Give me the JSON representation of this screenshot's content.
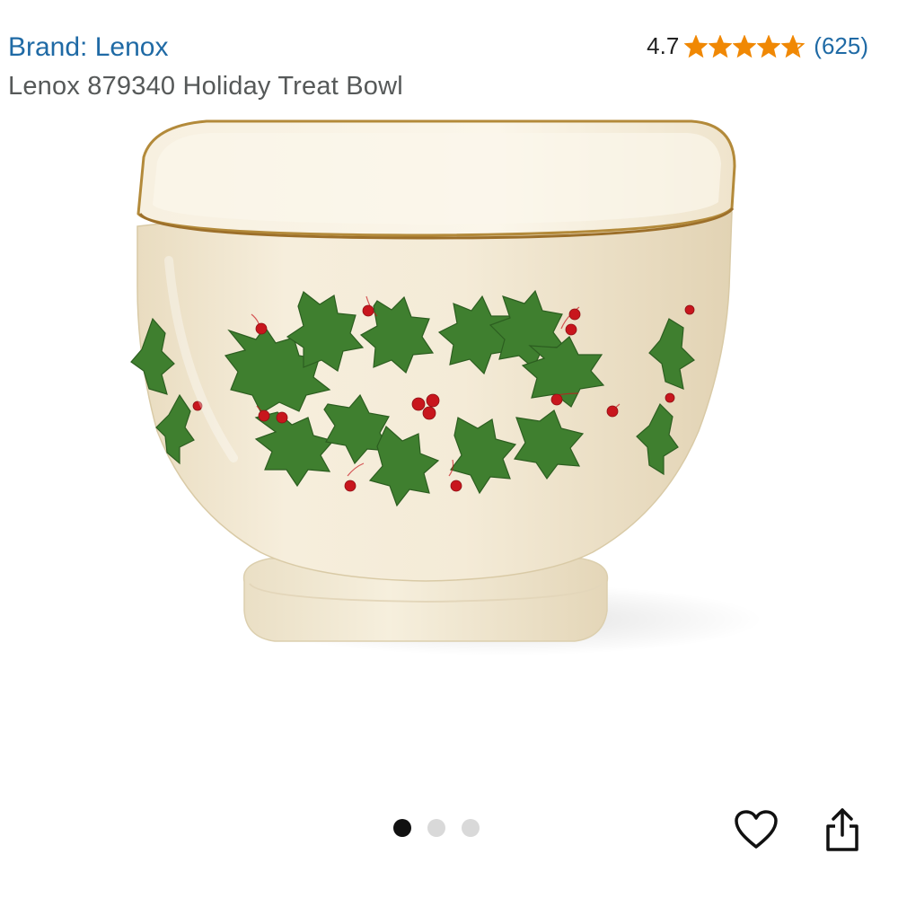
{
  "header": {
    "brand_link": "Brand: Lenox",
    "product_title": "Lenox 879340 Holiday Treat Bowl"
  },
  "rating": {
    "value": "4.7",
    "stars_filled": 4.7,
    "stars_total": 5,
    "review_count": "(625)",
    "star_color": "#f08804"
  },
  "gallery": {
    "image_count": 3,
    "active_index": 0,
    "image_subject": "holly-bowl"
  },
  "actions": {
    "wishlist_icon": "heart-outline-icon",
    "share_icon": "share-icon"
  },
  "colors": {
    "link": "#1f6aa5",
    "title": "#565959",
    "bowl_cream": "#f3ead6",
    "holly_green": "#3d7d2e",
    "berry_red": "#c8161d",
    "gold_rim": "#c49a4a"
  }
}
